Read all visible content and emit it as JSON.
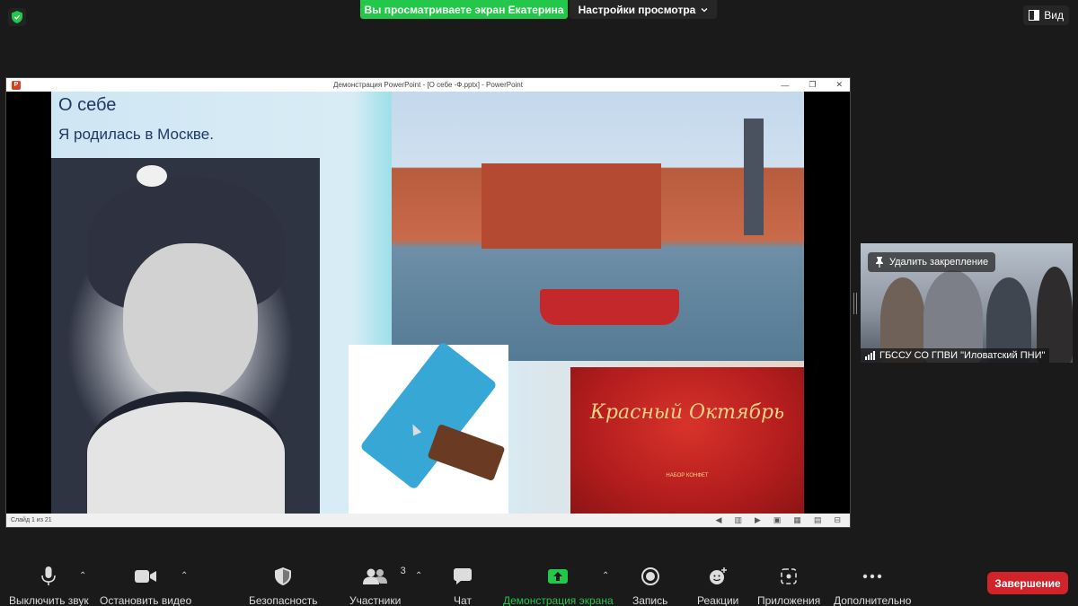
{
  "top_bar": {
    "share_banner": "Вы просматриваете экран Екатерина",
    "view_settings": "Настройки просмотра",
    "view_button": "Вид"
  },
  "ppt": {
    "window_title": "Демонстрация PowerPoint - [О себе -Ф.pptx] - PowerPoint",
    "slide_title": "О себе",
    "slide_subtitle": "Я родилась в Москве.",
    "candy_brand": "Красный Октябрь",
    "candy_set_label": "НАБОР КОНФЕТ",
    "status_text": "Слайд 1 из 21"
  },
  "participant": {
    "unpin_label": "Удалить закрепление",
    "name": "ГБССУ СО ГПВИ \"Иловатский ПНИ\""
  },
  "toolbar": {
    "mute": "Выключить звук",
    "stop_video": "Остановить видео",
    "security": "Безопасность",
    "participants": "Участники",
    "participants_count": "3",
    "chat": "Чат",
    "share_screen": "Демонстрация экрана",
    "record": "Запись",
    "reactions": "Реакции",
    "apps": "Приложения",
    "more": "Дополнительно",
    "end": "Завершение"
  },
  "colors": {
    "share_green": "#23c74a",
    "end_red": "#d0232a",
    "slide_title_blue": "#1f3864"
  }
}
